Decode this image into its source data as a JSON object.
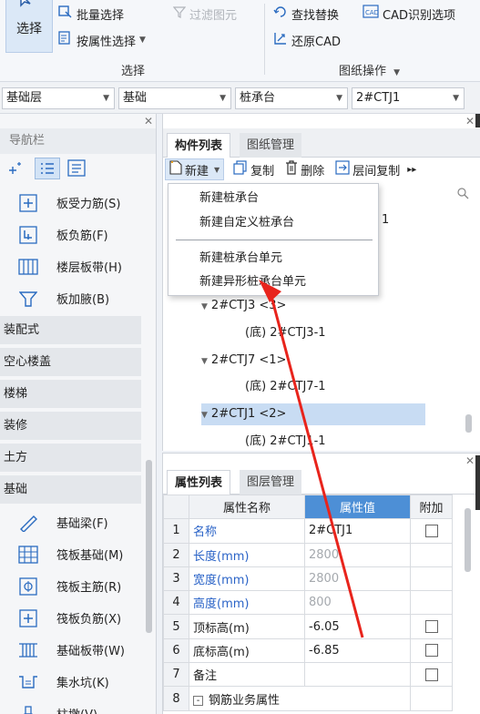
{
  "ribbon": {
    "select_label": "选择",
    "batch_select": "批量选择",
    "filter_elements": "过滤图元",
    "attr_select": "按属性选择",
    "group_select": "选择",
    "find_replace": "查找替换",
    "cad_recognize": "CAD识别选项",
    "restore_cad": "还原CAD",
    "group_drawing": "图纸操作"
  },
  "selectors": {
    "floor": "基础层",
    "category": "基础",
    "type": "桩承台",
    "item": "2#CTJ1"
  },
  "nav": {
    "title": "导航栏",
    "items_top": [
      {
        "label": "板受力筋(S)",
        "icon": "slab-rebar-icon"
      },
      {
        "label": "板负筋(F)",
        "icon": "slab-negative-rebar-icon"
      },
      {
        "label": "楼层板带(H)",
        "icon": "floor-strip-icon"
      },
      {
        "label": "板加腋(B)",
        "icon": "slab-haunch-icon"
      }
    ],
    "categories": [
      "装配式",
      "空心楼盖",
      "楼梯",
      "装修",
      "土方",
      "基础"
    ],
    "items_bottom": [
      {
        "label": "基础梁(F)",
        "icon": "foundation-beam-icon"
      },
      {
        "label": "筏板基础(M)",
        "icon": "raft-foundation-icon"
      },
      {
        "label": "筏板主筋(R)",
        "icon": "raft-main-rebar-icon"
      },
      {
        "label": "筏板负筋(X)",
        "icon": "raft-negative-rebar-icon"
      },
      {
        "label": "基础板带(W)",
        "icon": "foundation-strip-icon"
      },
      {
        "label": "集水坑(K)",
        "icon": "sump-pit-icon"
      },
      {
        "label": "柱墩(V)",
        "icon": "column-pier-icon"
      }
    ]
  },
  "component_panel": {
    "tabs": [
      "构件列表",
      "图纸管理"
    ],
    "toolbar": {
      "new": "新建",
      "copy": "复制",
      "delete": "删除",
      "floor_copy": "层间复制"
    },
    "tree": [
      {
        "label": "2#CTJ3 <3>",
        "level": 0
      },
      {
        "label": "(底) 2#CTJ3-1",
        "level": 1
      },
      {
        "label": "2#CTJ7 <1>",
        "level": 0
      },
      {
        "label": "(底) 2#CTJ7-1",
        "level": 1
      },
      {
        "label": "2#CTJ1 <2>",
        "level": 0,
        "selected": true
      },
      {
        "label": "(底) 2#CTJ1-1",
        "level": 1
      }
    ],
    "partial_row_tail": "1"
  },
  "new_menu": {
    "items": [
      "新建桩承台",
      "新建自定义桩承台",
      "新建桩承台单元",
      "新建异形桩承台单元"
    ]
  },
  "properties": {
    "tabs": [
      "属性列表",
      "图层管理"
    ],
    "headers": [
      "属性名称",
      "属性值",
      "附加"
    ],
    "rows": [
      {
        "num": "1",
        "name": "名称",
        "value": "2#CTJ1",
        "blue": true,
        "grey": false,
        "check": true
      },
      {
        "num": "2",
        "name": "长度(mm)",
        "value": "2800",
        "blue": true,
        "grey": true,
        "check": false
      },
      {
        "num": "3",
        "name": "宽度(mm)",
        "value": "2800",
        "blue": true,
        "grey": true,
        "check": false
      },
      {
        "num": "4",
        "name": "高度(mm)",
        "value": "800",
        "blue": true,
        "grey": true,
        "check": false
      },
      {
        "num": "5",
        "name": "顶标高(m)",
        "value": "-6.05",
        "blue": false,
        "grey": false,
        "check": true
      },
      {
        "num": "6",
        "name": "底标高(m)",
        "value": "-6.85",
        "blue": false,
        "grey": false,
        "check": true
      },
      {
        "num": "7",
        "name": "备注",
        "value": "",
        "blue": false,
        "grey": false,
        "check": true
      },
      {
        "num": "8",
        "name": "钢筋业务属性",
        "value": "",
        "blue": false,
        "grey": false,
        "check": false,
        "expander": "-"
      }
    ]
  },
  "colors": {
    "accent": "#4d8fd6",
    "selection": "#c8dcf3",
    "annotation_arrow": "#e8241c"
  }
}
